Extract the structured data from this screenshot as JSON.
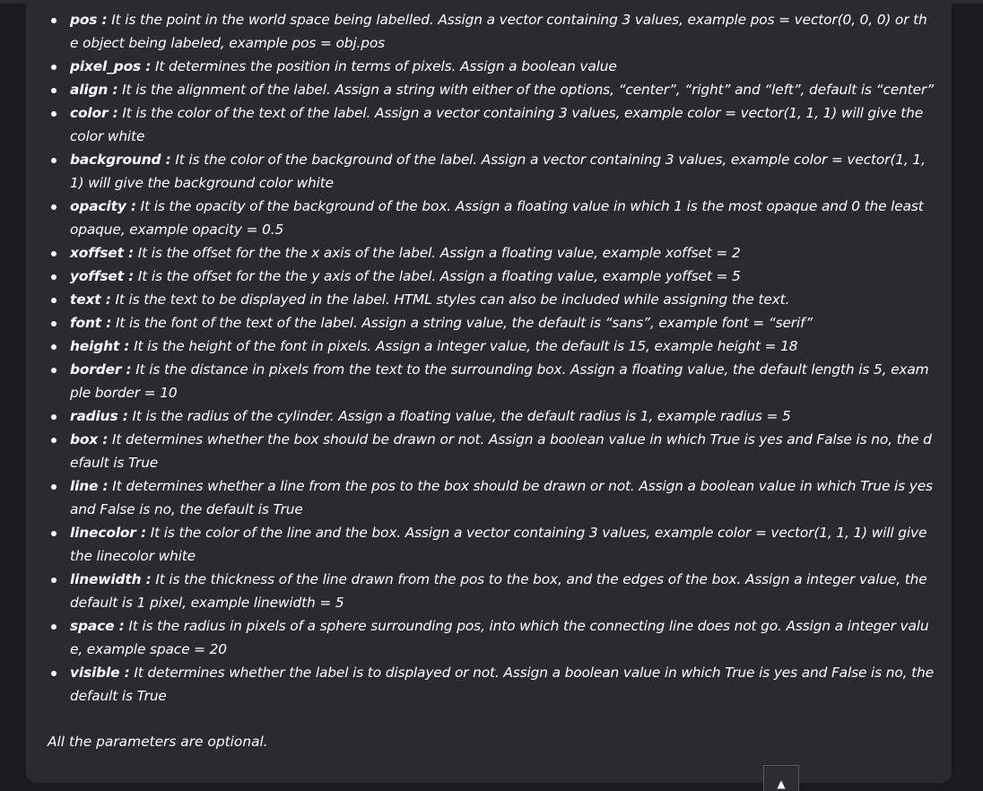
{
  "params": [
    {
      "term": "pos :",
      "desc": " It is the point in the world space being labelled. Assign a vector containing 3 values, example pos = vector(0, 0, 0) or the object being labeled, example pos = obj.pos"
    },
    {
      "term": "pixel_pos :",
      "desc": " It determines the position in terms of pixels. Assign a boolean value"
    },
    {
      "term": "align :",
      "desc": " It is the alignment of the label. Assign a string with either of the options, “center”, “right” and “left”, default is “center”"
    },
    {
      "term": "color :",
      "desc": " It is the color of the text of the label. Assign a vector containing 3 values, example color = vector(1, 1, 1) will give the color white"
    },
    {
      "term": "background :",
      "desc": " It is the color of the background of the label. Assign a vector containing 3 values, example color = vector(1, 1, 1) will give the background color white"
    },
    {
      "term": "opacity :",
      "desc": " It is the opacity of the background of the box. Assign a floating value in which 1 is the most opaque and 0 the least opaque, example opacity = 0.5"
    },
    {
      "term": "xoffset :",
      "desc": " It is the offset for the the x axis of the label. Assign a floating value, example xoffset = 2"
    },
    {
      "term": "yoffset :",
      "desc": " It is the offset for the the y axis of the label. Assign a floating value, example yoffset = 5"
    },
    {
      "term": "text :",
      "desc": " It is the text to be displayed in the label. HTML styles can also be included while assigning the text."
    },
    {
      "term": "font :",
      "desc": " It is the font of the text of the label. Assign a string value, the default is “sans”, example font = “serif”"
    },
    {
      "term": "height :",
      "desc": " It is the height of the font in pixels. Assign a integer value, the default is 15, example height = 18"
    },
    {
      "term": "border :",
      "desc": " It is the distance in pixels from the text to the surrounding box. Assign a floating value, the default length is 5, example border = 10"
    },
    {
      "term": "radius :",
      "desc": " It is the radius of the cylinder. Assign a floating value, the default radius is 1, example radius = 5"
    },
    {
      "term": "box :",
      "desc": " It determines whether the box should be drawn or not. Assign a boolean value in which True is yes and False is no, the default is True"
    },
    {
      "term": "line :",
      "desc": " It determines whether a line from the pos to the box should be drawn or not. Assign a boolean value in which True is yes and False is no, the default is True"
    },
    {
      "term": "linecolor :",
      "desc": " It is the color of the line and the box. Assign a vector containing 3 values, example color = vector(1, 1, 1) will give the linecolor white"
    },
    {
      "term": "linewidth :",
      "desc": " It is the thickness of the line drawn from the pos to the box, and the edges of the box. Assign a integer value, the default is 1 pixel, example linewidth = 5"
    },
    {
      "term": "space :",
      "desc": " It is the radius in pixels of a sphere surrounding pos, into which the connecting line does not go. Assign a integer value, example space = 20"
    },
    {
      "term": "visible :",
      "desc": " It determines whether the label is to displayed or not. Assign a boolean value in which True is yes and False is no, the default is True"
    }
  ],
  "footnote": "All the parameters are optional.",
  "scroll_top_glyph": "▲",
  "colors": {
    "page_background": "#1a1b1d",
    "card_background": "#2a2b2e",
    "text": "#ffffff"
  }
}
